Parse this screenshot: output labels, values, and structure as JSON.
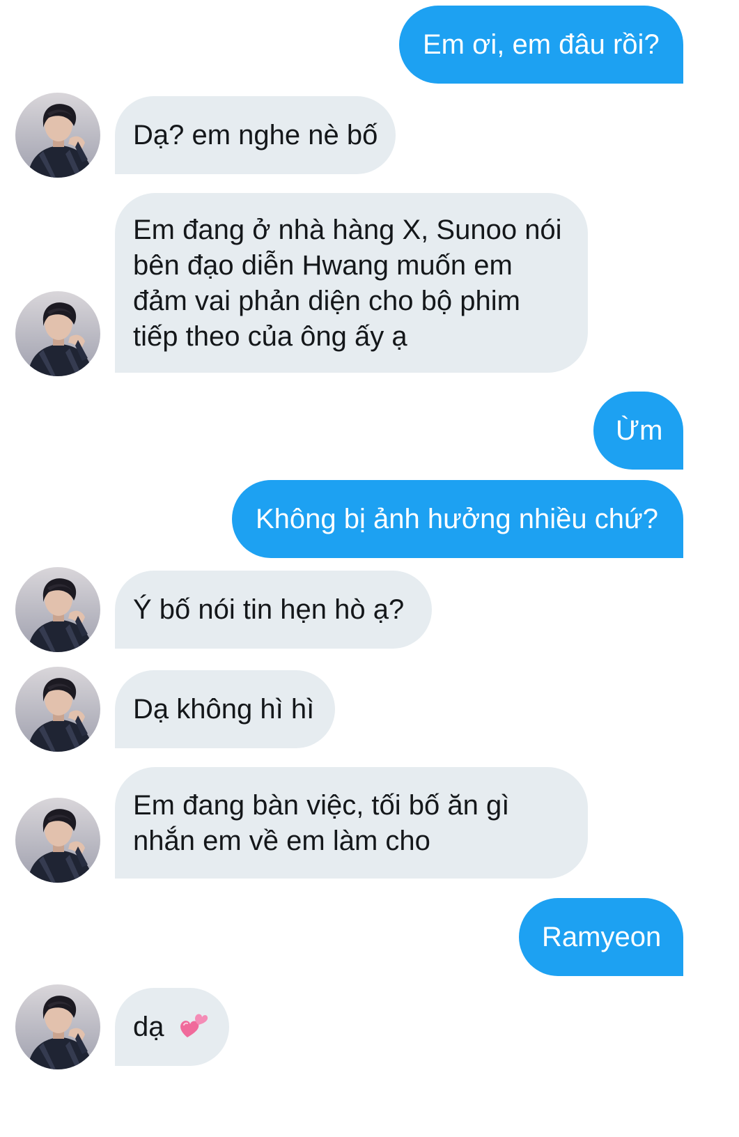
{
  "conversation": {
    "messages": [
      {
        "sender": "me",
        "text": "Em ơi, em đâu rồi?"
      },
      {
        "sender": "contact",
        "text": "Dạ? em nghe nè bố"
      },
      {
        "sender": "contact",
        "text": "Em đang ở nhà hàng X, Sunoo nói\nbên đạo diễn Hwang muốn em\nđảm vai phản diện cho bộ phim\ntiếp theo của ông ấy ạ"
      },
      {
        "sender": "me",
        "text": "Ừm"
      },
      {
        "sender": "me",
        "text": "Không bị ảnh hưởng nhiều chứ?"
      },
      {
        "sender": "contact",
        "text": "Ý bố nói tin hẹn hò ạ?"
      },
      {
        "sender": "contact",
        "text": "Dạ không hì hì"
      },
      {
        "sender": "contact",
        "text": "Em đang bàn việc, tối bố ăn gì\nnhắn em về em làm cho"
      },
      {
        "sender": "me",
        "text": "Ramyeon"
      },
      {
        "sender": "contact",
        "text": "dạ",
        "emoji": "💕"
      }
    ]
  },
  "colors": {
    "outgoing_bubble": "#1da1f2",
    "incoming_bubble": "#e6ecf0",
    "outgoing_text": "#ffffff",
    "incoming_text": "#14171a"
  },
  "icons": {
    "contact_avatar": "contact-avatar-photo",
    "emoji": "two-hearts-emoji"
  }
}
